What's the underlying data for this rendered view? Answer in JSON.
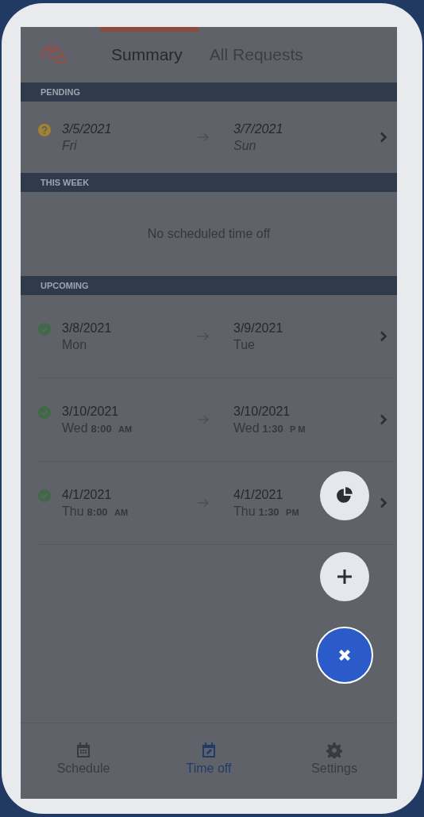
{
  "tabs": [
    {
      "label": "Summary",
      "selected": true
    },
    {
      "label": "All Requests",
      "selected": false
    }
  ],
  "sections": [
    {
      "title": "PENDING",
      "rows": [
        {
          "kind": "pending",
          "from": {
            "date": "3/5/2021",
            "day": "Fri"
          },
          "to": {
            "date": "3/7/2021",
            "day": "Sun"
          }
        }
      ]
    },
    {
      "title": "THIS WEEK",
      "empty_text": "No scheduled time off"
    },
    {
      "title": "UPCOMING",
      "rows": [
        {
          "kind": "approved",
          "from": {
            "date": "3/8/2021",
            "day": "Mon"
          },
          "to": {
            "date": "3/9/2021",
            "day": "Tue"
          }
        },
        {
          "kind": "approved",
          "from": {
            "date": "3/10/2021",
            "day": "Wed",
            "time": "8:00",
            "meridiem": "AM"
          },
          "to": {
            "date": "3/10/2021",
            "day": "Wed",
            "time": "1:30",
            "meridiem": "P M"
          }
        },
        {
          "kind": "approved",
          "from": {
            "date": "4/1/2021",
            "day": "Thu",
            "time": "8:00",
            "meridiem": "AM"
          },
          "to": {
            "date": "4/1/2021",
            "day": "Thu",
            "time": "1:30",
            "meridiem": "PM"
          }
        }
      ]
    }
  ],
  "fab_actions": [
    {
      "kind": "chart"
    },
    {
      "kind": "add"
    },
    {
      "kind": "close"
    }
  ],
  "nav": [
    {
      "label": "Schedule",
      "selected": false
    },
    {
      "label": "Time off",
      "selected": true
    },
    {
      "label": "Settings",
      "selected": false
    }
  ]
}
